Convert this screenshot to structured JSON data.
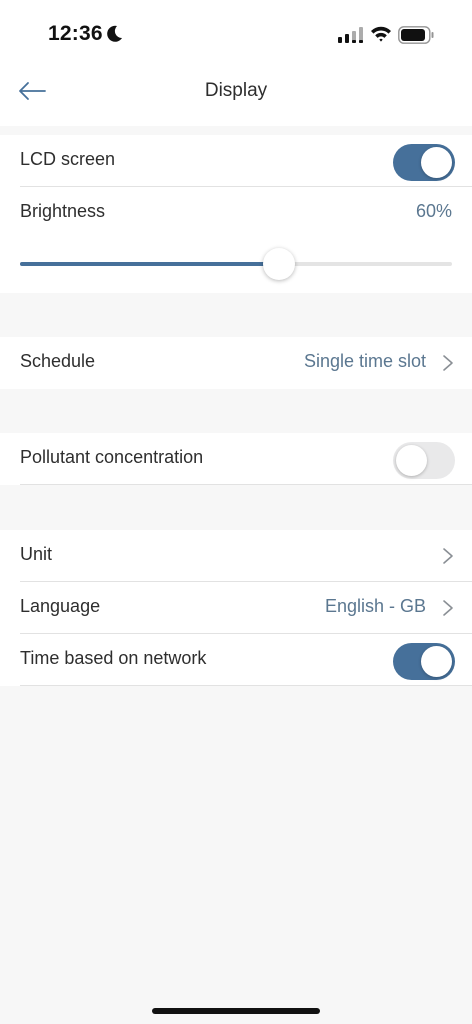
{
  "status_bar": {
    "time": "12:36",
    "moon_icon": "moon-icon",
    "signal_icon": "cellular-signal-icon",
    "wifi_icon": "wifi-icon",
    "battery_icon": "battery-icon"
  },
  "header": {
    "title": "Display",
    "back_icon": "back-arrow-icon"
  },
  "display_section": {
    "lcd_label": "LCD screen",
    "lcd_on": true,
    "brightness_label": "Brightness",
    "brightness_value": "60%",
    "brightness_level": 0.6
  },
  "schedule": {
    "label": "Schedule",
    "value": "Single time slot"
  },
  "pollutant": {
    "label": "Pollutant concentration",
    "on": false
  },
  "settings": {
    "unit_label": "Unit",
    "language_label": "Language",
    "language_value": "English - GB",
    "network_time_label": "Time based on network",
    "network_time_on": true
  },
  "colors": {
    "accent": "#46709a",
    "value_text": "#5b7790",
    "background": "#f7f7f7"
  }
}
